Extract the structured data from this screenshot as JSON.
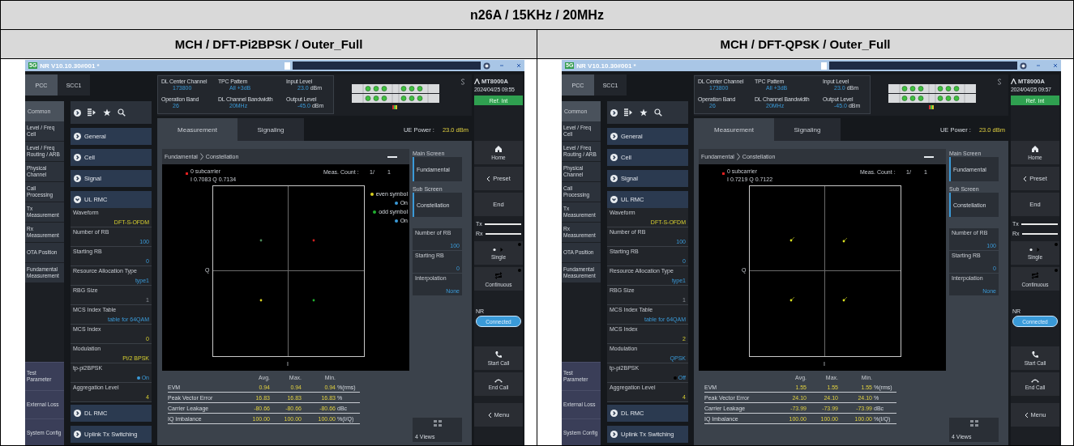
{
  "table": {
    "title": "n26A / 15KHz / 20MHz",
    "panels": [
      {
        "heading": "MCH / DFT-Pi2BPSK / Outer_Full",
        "screen": {
          "badge": "5G",
          "title": "NR V10.10.30#001 *",
          "carrier_tabs": [
            {
              "label": "PCC",
              "selected": true
            },
            {
              "label": "SCC1",
              "selected": false
            }
          ],
          "nav_header": "Common",
          "nav": [
            "Level / Freq Cell",
            "Level / Freq Routing / ARB",
            "Physical Channel",
            "Call Processing",
            "Tx Measurement",
            "Rx Measurement",
            "OTA Position",
            "Fundamental Measurement"
          ],
          "nav_bottom": [
            "Test Parameter",
            "External Loss",
            "System Config"
          ],
          "sections_top": [
            {
              "label": "General",
              "expanded": false
            },
            {
              "label": "Cell",
              "expanded": false
            },
            {
              "label": "Signal",
              "expanded": false
            },
            {
              "label": "UL RMC",
              "expanded": true
            }
          ],
          "params": [
            {
              "kind": "current",
              "label": "Waveform",
              "value": "DFT-S-OFDM"
            },
            {
              "kind": "setting",
              "label": "Number of RB",
              "value": "100"
            },
            {
              "kind": "setting",
              "label": "Starting RB",
              "value": "0"
            },
            {
              "kind": "setting",
              "label": "Resource Allocation Type",
              "value": "type1"
            },
            {
              "kind": "fixed",
              "label": "RBG Size",
              "value": "1"
            },
            {
              "kind": "setting",
              "label": "MCS Index Table",
              "value": "table for 64QAM"
            },
            {
              "kind": "current",
              "label": "MCS Index",
              "value": "0"
            },
            {
              "kind": "current",
              "label": "Modulation",
              "value": "Pi/2 BPSK"
            },
            {
              "kind": "toggle",
              "label": "tp-pi2BPSK",
              "value": "On",
              "on": true
            },
            {
              "kind": "current",
              "label": "Aggregation Level",
              "value": "4"
            }
          ],
          "sections_bottom": [
            {
              "label": "DL RMC",
              "expanded": false
            },
            {
              "label": "Uplink Tx Switching",
              "expanded": false
            }
          ],
          "info": [
            {
              "label": "DL Center Channel",
              "value": "173800"
            },
            {
              "label": "TPC Pattern",
              "value": "All +3dB"
            },
            {
              "label": "Input Level",
              "value": "23.0",
              "unit": "dBm"
            },
            {
              "label": "Operation Band",
              "value": "26"
            },
            {
              "label": "DL Channel Bandwidth",
              "value": "20MHz"
            },
            {
              "label": "Output Level",
              "value": "-45.0",
              "unit": "dBm"
            }
          ],
          "view_tabs": [
            {
              "label": "Measurement",
              "selected": true
            },
            {
              "label": "Signaling",
              "selected": false
            }
          ],
          "ue_power": {
            "label": "UE Power :",
            "value": "23.0 dBm"
          },
          "breadcrumb": [
            "Fundamental",
            "Constellation"
          ],
          "marker": {
            "label": "0 subcarrier",
            "coords": "I 0.7083 Q 0.7134"
          },
          "meas_count": {
            "label": "Meas. Count :",
            "value": "1/",
            "total": "1"
          },
          "legend": [
            {
              "label": "even symbol",
              "color": "#d8d020",
              "state": "On",
              "on": true
            },
            {
              "label": "odd symbol",
              "color": "#20b030",
              "state": "On",
              "on": true
            }
          ],
          "constellation": {
            "kind": "pi2bpsk"
          },
          "axis_q": "Q",
          "axis_i": "I",
          "results": {
            "columns": [
              "Avg.",
              "Max.",
              "Min."
            ],
            "rows": [
              {
                "label": "EVM",
                "values": [
                  "0.94",
                  "0.94",
                  "0.94"
                ],
                "unit": "%(rms)"
              },
              {
                "label": "Peak Vector Error",
                "values": [
                  "16.83",
                  "16.83",
                  "16.83"
                ],
                "unit": "%"
              },
              {
                "label": "Carrier Leakage",
                "values": [
                  "-80.66",
                  "-80.66",
                  "-80.66"
                ],
                "unit": "dBc"
              },
              {
                "label": "IQ Imbalance",
                "values": [
                  "100.00",
                  "100.00",
                  "100.00"
                ],
                "unit": "%(I/Q)"
              }
            ]
          },
          "screen_menu": [
            {
              "heading": "Main Screen",
              "item": "Fundamental",
              "selected": true
            },
            {
              "heading": "Sub Screen",
              "item": "Constellation",
              "selected": true
            }
          ],
          "side_params": [
            {
              "label": "Number of RB",
              "value": "100"
            },
            {
              "label": "Starting RB",
              "value": "0"
            },
            {
              "label": "Interpolation",
              "value": "None"
            }
          ],
          "views_button": "4 Views",
          "brand": "MT8000A",
          "datetime": "2024/04/25 09:55",
          "ref_status": "Ref. Int",
          "toolbar": [
            {
              "kind": "home",
              "label": "Home"
            },
            {
              "kind": "back",
              "label": "Preset"
            },
            {
              "kind": "plain",
              "label": "End"
            },
            {
              "kind": "links",
              "labels": [
                "Tx",
                "Rx"
              ]
            },
            {
              "kind": "single",
              "label": "Single"
            },
            {
              "kind": "continuous",
              "label": "Continuous"
            },
            {
              "kind": "status",
              "label": "NR",
              "value": "Connected"
            },
            {
              "kind": "call",
              "label": "Start Call"
            },
            {
              "kind": "hangup",
              "label": "End Call"
            },
            {
              "kind": "back",
              "label": "Menu"
            }
          ]
        }
      },
      {
        "heading": "MCH / DFT-QPSK / Outer_Full",
        "screen": {
          "badge": "5G",
          "title": "NR V10.10.30#001 *",
          "carrier_tabs": [
            {
              "label": "PCC",
              "selected": true
            },
            {
              "label": "SCC1",
              "selected": false
            }
          ],
          "nav_header": "Common",
          "nav": [
            "Level / Freq Cell",
            "Level / Freq Routing / ARB",
            "Physical Channel",
            "Call Processing",
            "Tx Measurement",
            "Rx Measurement",
            "OTA Position",
            "Fundamental Measurement"
          ],
          "nav_bottom": [
            "Test Parameter",
            "External Loss",
            "System Config"
          ],
          "sections_top": [
            {
              "label": "General",
              "expanded": false
            },
            {
              "label": "Cell",
              "expanded": false
            },
            {
              "label": "Signal",
              "expanded": false
            },
            {
              "label": "UL RMC",
              "expanded": true
            }
          ],
          "params": [
            {
              "kind": "current",
              "label": "Waveform",
              "value": "DFT-S-OFDM"
            },
            {
              "kind": "setting",
              "label": "Number of RB",
              "value": "100"
            },
            {
              "kind": "setting",
              "label": "Starting RB",
              "value": "0"
            },
            {
              "kind": "setting",
              "label": "Resource Allocation Type",
              "value": "type1"
            },
            {
              "kind": "fixed",
              "label": "RBG Size",
              "value": "1"
            },
            {
              "kind": "setting",
              "label": "MCS Index Table",
              "value": "table for 64QAM"
            },
            {
              "kind": "current",
              "label": "MCS Index",
              "value": "2"
            },
            {
              "kind": "setting",
              "label": "Modulation",
              "value": "QPSK"
            },
            {
              "kind": "toggle",
              "label": "tp-pi2BPSK",
              "value": "Off",
              "on": false
            },
            {
              "kind": "current",
              "label": "Aggregation Level",
              "value": "4"
            }
          ],
          "sections_bottom": [
            {
              "label": "DL RMC",
              "expanded": false
            },
            {
              "label": "Uplink Tx Switching",
              "expanded": false
            }
          ],
          "info": [
            {
              "label": "DL Center Channel",
              "value": "173800"
            },
            {
              "label": "TPC Pattern",
              "value": "All +3dB"
            },
            {
              "label": "Input Level",
              "value": "23.0",
              "unit": "dBm"
            },
            {
              "label": "Operation Band",
              "value": "26"
            },
            {
              "label": "DL Channel Bandwidth",
              "value": "20MHz"
            },
            {
              "label": "Output Level",
              "value": "-45.0",
              "unit": "dBm"
            }
          ],
          "view_tabs": [
            {
              "label": "Measurement",
              "selected": true
            },
            {
              "label": "Signaling",
              "selected": false
            }
          ],
          "ue_power": {
            "label": "UE Power :",
            "value": "23.0 dBm"
          },
          "breadcrumb": [
            "Fundamental",
            "Constellation"
          ],
          "marker": {
            "label": "0 subcarrier",
            "coords": "I 0.7219 Q 0.7122"
          },
          "meas_count": {
            "label": "Meas. Count :",
            "value": "1/",
            "total": "1"
          },
          "constellation": {
            "kind": "qpsk"
          },
          "axis_q": "Q",
          "axis_i": "I",
          "results": {
            "columns": [
              "Avg.",
              "Max.",
              "Min."
            ],
            "rows": [
              {
                "label": "EVM",
                "values": [
                  "1.55",
                  "1.55",
                  "1.55"
                ],
                "unit": "%(rms)"
              },
              {
                "label": "Peak Vector Error",
                "values": [
                  "24.10",
                  "24.10",
                  "24.10"
                ],
                "unit": "%"
              },
              {
                "label": "Carrier Leakage",
                "values": [
                  "-73.99",
                  "-73.99",
                  "-73.99"
                ],
                "unit": "dBc"
              },
              {
                "label": "IQ Imbalance",
                "values": [
                  "100.00",
                  "100.00",
                  "100.00"
                ],
                "unit": "%(I/Q)"
              }
            ]
          },
          "screen_menu": [
            {
              "heading": "Main Screen",
              "item": "Fundamental",
              "selected": true
            },
            {
              "heading": "Sub Screen",
              "item": "Constellation",
              "selected": true
            }
          ],
          "side_params": [
            {
              "label": "Number of RB",
              "value": "100"
            },
            {
              "label": "Starting RB",
              "value": "0"
            },
            {
              "label": "Interpolation",
              "value": "None"
            }
          ],
          "views_button": "4 Views",
          "brand": "MT8000A",
          "datetime": "2024/04/25 09:57",
          "ref_status": "Ref. Int",
          "toolbar": [
            {
              "kind": "home",
              "label": "Home"
            },
            {
              "kind": "back",
              "label": "Preset"
            },
            {
              "kind": "plain",
              "label": "End"
            },
            {
              "kind": "links",
              "labels": [
                "Tx",
                "Rx"
              ]
            },
            {
              "kind": "single",
              "label": "Single"
            },
            {
              "kind": "continuous",
              "label": "Continuous"
            },
            {
              "kind": "status",
              "label": "NR",
              "value": "Connected"
            },
            {
              "kind": "call",
              "label": "Start Call"
            },
            {
              "kind": "hangup",
              "label": "End Call"
            },
            {
              "kind": "back",
              "label": "Menu"
            }
          ]
        }
      }
    ]
  }
}
